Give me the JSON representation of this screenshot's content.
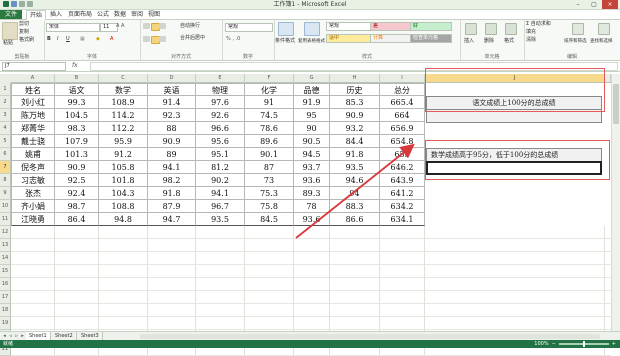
{
  "window": {
    "title": "工作簿1 - Microsoft Excel",
    "controls": [
      "–",
      "▢",
      "×"
    ]
  },
  "tabs": [
    "文件",
    "开始",
    "插入",
    "页面布局",
    "公式",
    "数据",
    "审阅",
    "视图"
  ],
  "ribbon": {
    "clipboard": {
      "paste": "粘贴",
      "cut": "剪切",
      "copy": "复制",
      "format_painter": "格式刷",
      "label": "剪贴板"
    },
    "font": {
      "name": "宋体",
      "size": "11",
      "label": "字体"
    },
    "alignment": {
      "wrap": "自动换行",
      "merge": "合并后居中",
      "label": "对齐方式"
    },
    "number": {
      "format": "常规",
      "label": "数字"
    },
    "styles": {
      "conditional": "条件格式",
      "table": "套用表格格式",
      "cells": [
        {
          "text": "常规",
          "bg": "#ffffff",
          "fg": "#222222"
        },
        {
          "text": "差",
          "bg": "#f7c7ce",
          "fg": "#9c0006"
        },
        {
          "text": "好",
          "bg": "#c6efce",
          "fg": "#006100"
        },
        {
          "text": "适中",
          "bg": "#ffeb9c",
          "fg": "#9c6500"
        },
        {
          "text": "计算",
          "bg": "#f2f2f2",
          "fg": "#fa7d00"
        },
        {
          "text": "检查单元格",
          "bg": "#a5a5a5",
          "fg": "#ffffff"
        }
      ],
      "label": "样式"
    },
    "cells": {
      "insert": "插入",
      "delete": "删除",
      "format": "格式",
      "label": "单元格"
    },
    "editing": {
      "sum": "Σ 自动求和",
      "fill": "填充",
      "clear": "清除",
      "sort": "排序和筛选",
      "find": "查找和选择",
      "label": "编辑"
    }
  },
  "formula_bar": {
    "name_box": "J7",
    "fx": "fx",
    "value": ""
  },
  "columns": [
    "A",
    "B",
    "C",
    "D",
    "E",
    "F",
    "G",
    "H",
    "I",
    "J"
  ],
  "selected_column": "J",
  "selected_row": 7,
  "rows": [
    [
      "姓名",
      "语文",
      "数学",
      "英语",
      "物理",
      "化学",
      "品德",
      "历史",
      "总分"
    ],
    [
      "刘小红",
      "99.3",
      "108.9",
      "91.4",
      "97.6",
      "91",
      "91.9",
      "85.3",
      "665.4"
    ],
    [
      "陈万地",
      "104.5",
      "114.2",
      "92.3",
      "92.6",
      "74.5",
      "95",
      "90.9",
      "664"
    ],
    [
      "郑菁华",
      "98.3",
      "112.2",
      "88",
      "96.6",
      "78.6",
      "90",
      "93.2",
      "656.9"
    ],
    [
      "戴士骁",
      "107.9",
      "95.9",
      "90.9",
      "95.6",
      "89.6",
      "90.5",
      "84.4",
      "654.8"
    ],
    [
      "姚甫",
      "101.3",
      "91.2",
      "89",
      "95.1",
      "90.1",
      "94.5",
      "91.8",
      "653"
    ],
    [
      "倪冬声",
      "90.9",
      "105.8",
      "94.1",
      "81.2",
      "87",
      "93.7",
      "93.5",
      "646.2"
    ],
    [
      "习志敏",
      "92.5",
      "101.8",
      "98.2",
      "90.2",
      "73",
      "93.6",
      "94.6",
      "643.9"
    ],
    [
      "张杰",
      "92.4",
      "104.3",
      "91.8",
      "94.1",
      "75.3",
      "89.3",
      "94",
      "641.2"
    ],
    [
      "齐小娟",
      "98.7",
      "108.8",
      "87.9",
      "96.7",
      "75.8",
      "78",
      "88.3",
      "634.2"
    ],
    [
      "江晓勇",
      "86.4",
      "94.8",
      "94.7",
      "93.5",
      "84.5",
      "93.6",
      "86.6",
      "634.1"
    ]
  ],
  "annotations": {
    "j2": "语文成绩上100分的总成绩",
    "j6": "数学成绩高于95分，低于100分的总成绩",
    "box_color": "#e55a5a",
    "arrow_color": "#d9383b"
  },
  "sheets": [
    "Sheet1",
    "Sheet2",
    "Sheet3"
  ],
  "active_sheet": "Sheet1",
  "status": {
    "text": "就绪",
    "zoom": "100%"
  }
}
